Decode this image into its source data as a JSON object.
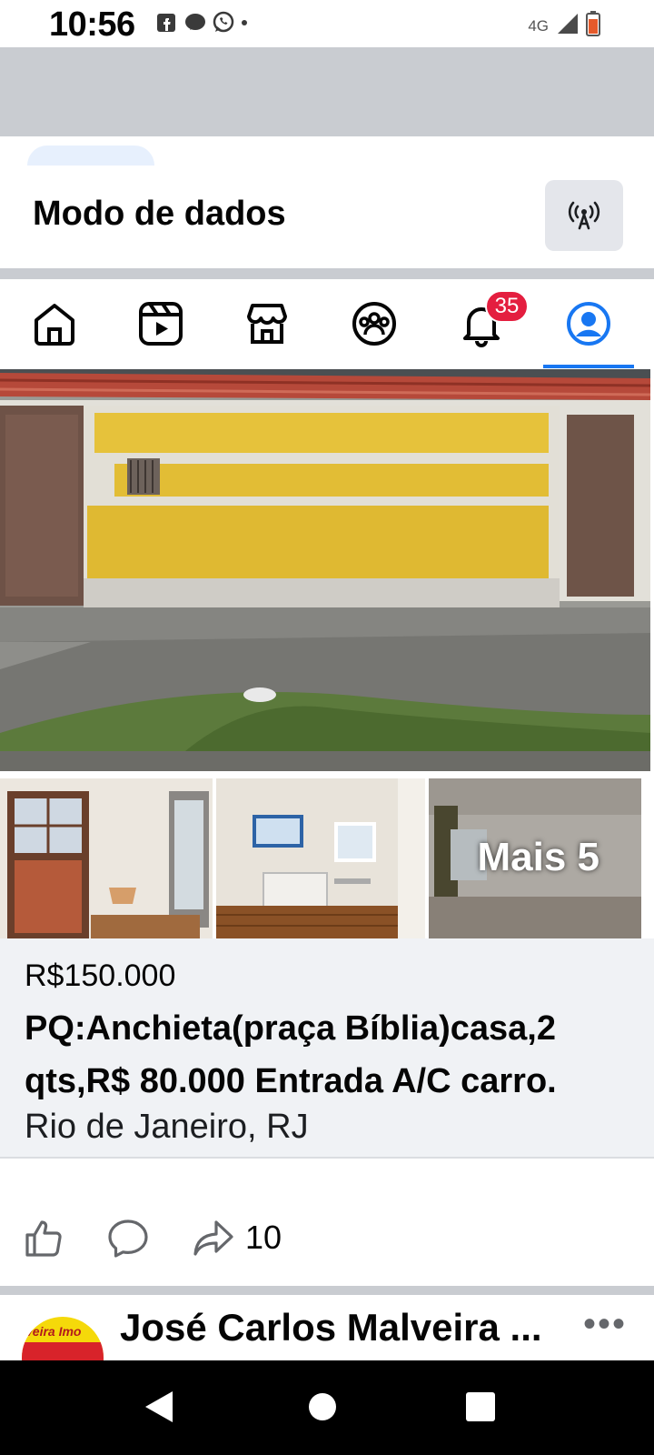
{
  "status_bar": {
    "time": "10:56",
    "network": "4G",
    "icons": [
      "facebook-icon",
      "messenger-icon",
      "whatsapp-icon",
      "signal-icon",
      "battery-icon"
    ]
  },
  "data_mode": {
    "title": "Modo de dados",
    "icon": "antenna-icon"
  },
  "nav": {
    "items": [
      {
        "name": "home",
        "icon": "home-icon"
      },
      {
        "name": "video",
        "icon": "video-icon"
      },
      {
        "name": "marketplace",
        "icon": "marketplace-icon"
      },
      {
        "name": "groups",
        "icon": "groups-icon"
      },
      {
        "name": "notifications",
        "icon": "bell-icon",
        "badge": "35"
      },
      {
        "name": "profile",
        "icon": "profile-icon",
        "active": true
      }
    ],
    "accent_color": "#1877f2"
  },
  "photos": {
    "more_label": "Mais 5"
  },
  "listing": {
    "price": "R$150.000",
    "title": "PQ:Anchieta(praça Bíblia)casa,2 qts,R$ 80.000 Entrada A/C carro.",
    "location": "Rio de Janeiro, RJ"
  },
  "actions": {
    "like_icon": "like-icon",
    "comment_icon": "comment-icon",
    "share_icon": "share-icon",
    "share_count": "10"
  },
  "next_post": {
    "poster_name": "José Carlos Malveira ...",
    "avatar_text": "veira Imo"
  },
  "android_nav": [
    "back-icon",
    "home-icon",
    "recents-icon"
  ]
}
